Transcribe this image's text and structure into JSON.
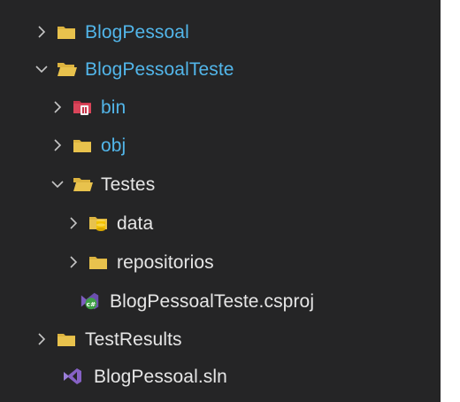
{
  "explorer": {
    "items": [
      {
        "label": "BlogPessoal",
        "icon": "folder-closed-icon",
        "state": "collapsed",
        "color": "#52b6ea"
      },
      {
        "label": "BlogPessoalTeste",
        "icon": "folder-open-icon",
        "state": "expanded",
        "color": "#52b6ea"
      },
      {
        "label": "bin",
        "icon": "folder-bin-icon",
        "state": "collapsed",
        "color": "#52b6ea"
      },
      {
        "label": "obj",
        "icon": "folder-closed-icon",
        "state": "collapsed",
        "color": "#52b6ea"
      },
      {
        "label": "Testes",
        "icon": "folder-open-icon",
        "state": "expanded",
        "color": "#e6e6e6"
      },
      {
        "label": "data",
        "icon": "folder-database-icon",
        "state": "collapsed",
        "color": "#e6e6e6"
      },
      {
        "label": "repositorios",
        "icon": "folder-closed-icon",
        "state": "collapsed",
        "color": "#e6e6e6"
      },
      {
        "label": "BlogPessoalTeste.csproj",
        "icon": "csproj-file-icon",
        "state": "file",
        "color": "#e6e6e6"
      },
      {
        "label": "TestResults",
        "icon": "folder-closed-icon",
        "state": "collapsed",
        "color": "#e6e6e6"
      },
      {
        "label": "BlogPessoal.sln",
        "icon": "visual-studio-sln-icon",
        "state": "file",
        "color": "#e6e6e6"
      }
    ]
  },
  "colors": {
    "background": "#252526",
    "folder": "#dcb33f",
    "chevron": "#c5c5c5"
  }
}
